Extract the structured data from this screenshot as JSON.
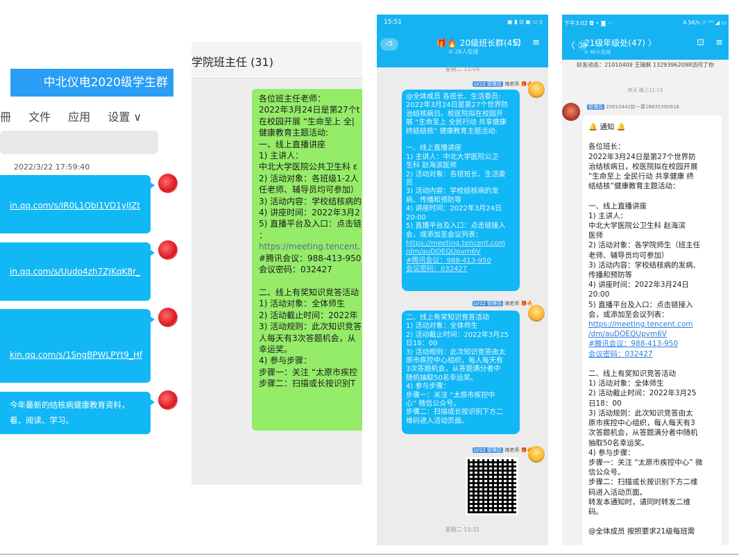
{
  "panel1": {
    "group_title": "中北仪电2020级学生群",
    "tabs": [
      "冊",
      "文件",
      "应用",
      "设置 ∨"
    ],
    "timestamp": "2022/3/22 17:59:40",
    "links": [
      "in.qq.com/s/IR0L1ObI1VD1yIJZt",
      "in.qq.com/s/Uudo4zh7ZJKqK8r_",
      "kin.qq.com/s/1SngBPWLPYt9_Hf"
    ],
    "last_message": [
      "今年最新的结核病健康教育资料，",
      "看、阅读、学习。"
    ]
  },
  "panel2": {
    "title": "学院班主任 (31)",
    "message": [
      "各位班主任老师：",
      "2022年3月24日是第27个t",
      "在校园开展 “生命至上 全|",
      "健康教育主题活动:",
      "一、线上直播讲座",
      "1) 主讲人：",
      "中北大学医院公共卫生科 ε",
      "2) 活动对象：各班级1-2人",
      "任老师、辅导员均可参加）",
      "3) 活动内容：学校结核病的",
      "4) 讲座时间：2022年3月2",
      "5) 直播平台及入口：点击链",
      "：",
      "https://meeting.tencent.",
      "#腾讯会议：988-413-950",
      "会议密码：032427",
      "",
      "二、线上有奖知识竞答活动",
      "1) 活动对象：全体师生",
      "2) 活动截止时间：2022年",
      "3) 活动规则：此次知识竞答",
      "人每天有3次答题机会，从",
      "幸运奖。",
      "4) 参与步骤：",
      "步骤一：关注 “太原市疾控",
      "步骤二：扫描或长按识别T"
    ]
  },
  "panel3": {
    "status_time": "15:51",
    "status_icons": "▣ ▮ ⊡ ▣ ▭ ▯",
    "back_count": "5",
    "group_name": "🎁🔥 20级班长群(45)",
    "group_sub": "⊙ 26人在线",
    "header_icons": "⊡ ≡",
    "time1": "星期二 11:04",
    "time2": "星期二 15:31",
    "sender_tag_label": "LV12 管理员",
    "sender_tag_name": "褚老师 🎁🔥",
    "msg1": [
      "@全体成员 各班长、生活委员:",
      "2022年3月24日是第27个世界防",
      "治结核病日。校医院拟在校园开",
      "展 “生命至上 全民行动 共享健康",
      "终结结核” 健康教育主题活动:",
      "",
      "一、线上直播讲座",
      "1) 主讲人：中北大学医院公卫",
      "生科 赵海滨医师",
      "2) 活动对象：各班班长、生活委",
      "员",
      "3) 活动内容：学校结核病的发",
      "病、传播和预防等",
      "4) 讲座时间：2022年3月24日",
      "20:00",
      "5) 直播平台及入口：点击链接入",
      "会，或添加至会议列表：",
      "https://meeting.tencent.com",
      "/dm/auDOEQUpvm6V",
      "#腾讯会议：988-413-950",
      "会议密码：032427"
    ],
    "msg2": [
      "二、线上有奖知识竞答活动",
      "1) 活动对象：全体师生",
      "2) 活动截止时间：2022年3月25",
      "日18：00",
      "3) 活动规则：此次知识竞答由太",
      "原市疾控中心组织，每人每天有",
      "3次答题机会，从答题满分者中",
      "随机抽取50名幸运奖。",
      "4) 参与步骤：",
      "步骤一：关注 “太原市疾控中",
      "心” 微信公众号。",
      "步骤二：扫描或长按识别下方二",
      "维码进入活动页面。"
    ]
  },
  "panel4": {
    "status_left": "下午3:02 ◘ • ◙ ···",
    "status_right": "4.5K/s ☉ ⁵ᴳ ◢ ▭",
    "back": "〈 ㉘",
    "group_name": "21级年级处(47) 〉",
    "group_sub": "⊙ 40人在线",
    "header_icons": "⊡ ≡",
    "notice": "好友动态：21010409 王瑞枫 13293962098访问了你",
    "time": "昨天 晚上11:13",
    "sender_label": "管理员",
    "sender_name": "20010442赵一尊18835390918",
    "message": [
      "🔔 通知 🔔",
      "",
      "各位班长：",
      "2022年3月24日是第27个世界防",
      "治结核病日，校医院拟在校园开展",
      "“生命至上 全民行动 共享健康 终",
      "结结核”健康教育主题活动：",
      "",
      "一、线上直播讲座",
      "1) 主讲人：",
      "中北大学医院公卫生科 赵海滨",
      "医师",
      "2) 活动对象：各学院师生（班主任",
      "老师、辅导员均可参加）",
      "3) 活动内容：学校结核病的发病、",
      "传播和预防等",
      "4) 讲座时间：2022年3月24日",
      "20:00",
      "5) 直播平台及入口：点击链接入",
      "会，或添加至会议列表：",
      "https://meeting.tencent.com",
      "/dm/auDOEQUpvm6V",
      "#腾讯会议：988-413-950",
      "会议密码：032427",
      "",
      "二、线上有奖知识竞答活动",
      "1) 活动对象：全体师生",
      "2) 活动截止时间：2022年3月25",
      "日18：00",
      "3) 活动规则：此次知识竞答由太",
      "原市疾控中心组织，每人每天有3",
      "次答题机会，从答题满分者中随机",
      "抽取50名幸运奖。",
      "4) 参与步骤：",
      "步骤一：关注 “太原市疾控中心” 微",
      "信公众号。",
      "步骤二：扫描或长按识别下方二维",
      "码进入活动页面。",
      "转发本通知时，请同时转发二维",
      "码。",
      "",
      "@全体成员 按照要求21级每班需"
    ]
  }
}
